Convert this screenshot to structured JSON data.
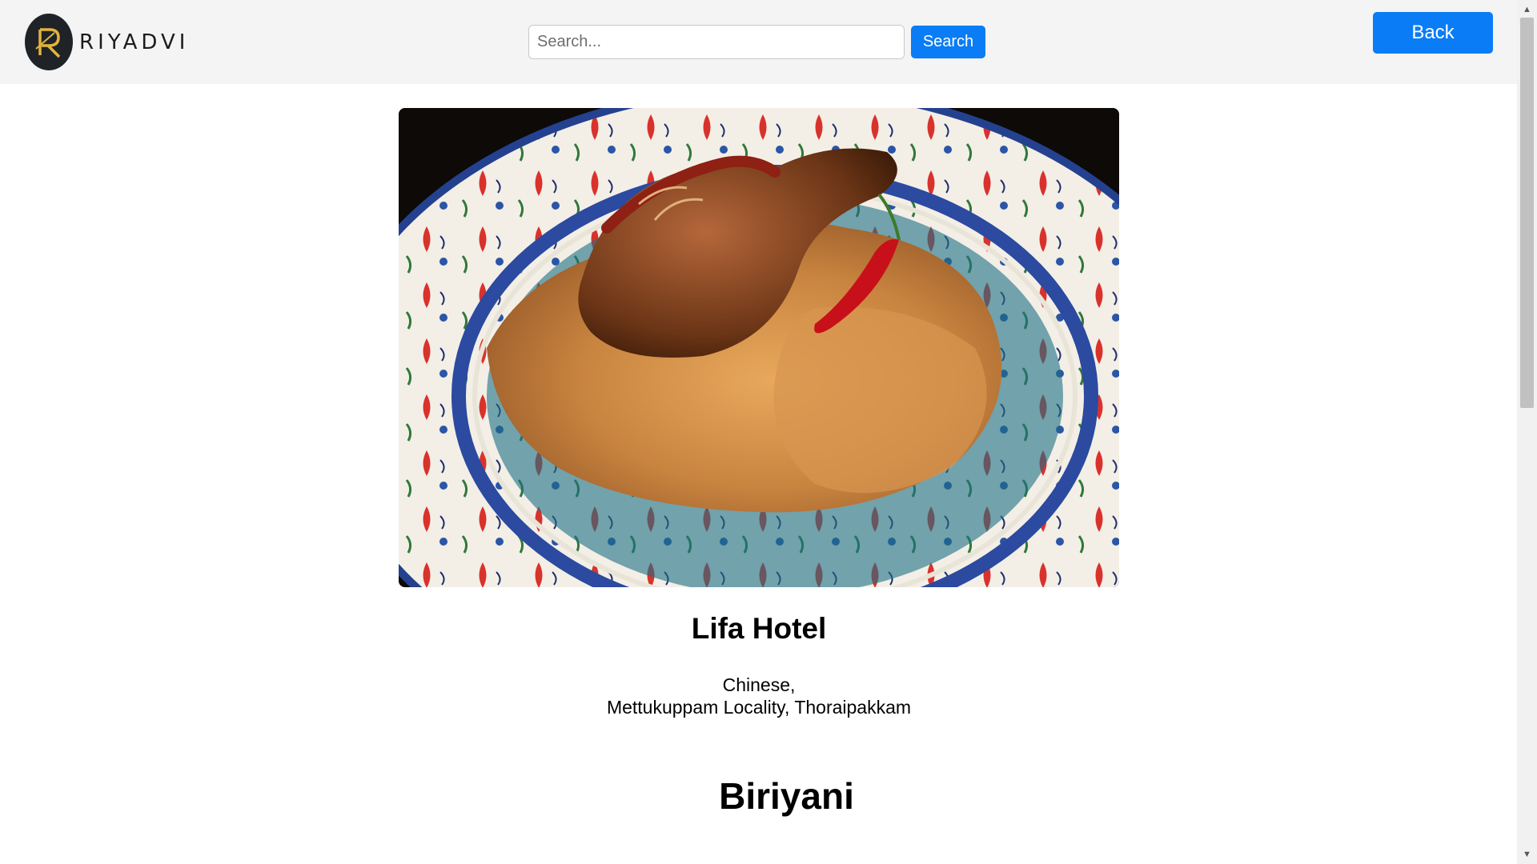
{
  "header": {
    "brand_name": "RIYADVI",
    "search_placeholder": "Search...",
    "search_label": "Search",
    "back_label": "Back"
  },
  "restaurant": {
    "name": "Lifa Hotel",
    "cuisine": "Chinese,",
    "locality": "Mettukuppam Locality, Thoraipakkam"
  },
  "dish": {
    "name": "Biriyani"
  },
  "colors": {
    "primary": "#0a7cf5",
    "header_bg": "#f4f4f4",
    "logo_bg": "#1f2327",
    "logo_gold": "#e2b43c"
  },
  "icons": {
    "logo": "r-monogram-icon",
    "scroll_up": "arrow-up-icon",
    "scroll_down": "arrow-down-icon"
  }
}
